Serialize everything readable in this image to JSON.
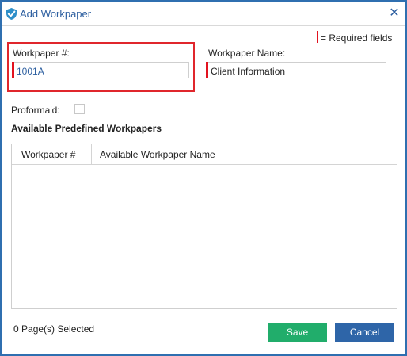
{
  "dialog": {
    "title": "Add Workpaper",
    "close_glyph": "✕"
  },
  "legend": {
    "required_text": "= Required fields",
    "required_color": "#e2131f"
  },
  "form": {
    "workpaper_number_label": "Workpaper #:",
    "workpaper_number_value": "1001A",
    "workpaper_name_label": "Workpaper Name:",
    "workpaper_name_value": "Client Information",
    "proforma_label": "Proforma'd:",
    "proforma_checked": false
  },
  "predefined": {
    "section_title": "Available Predefined Workpapers",
    "columns": [
      "Workpaper #",
      "Available Workpaper Name",
      ""
    ],
    "rows": []
  },
  "footer": {
    "selected_count": "0",
    "selected_label": "Page(s) Selected",
    "save_label": "Save",
    "cancel_label": "Cancel"
  },
  "icons": {
    "app": "check-shield-icon",
    "close": "close-icon"
  },
  "colors": {
    "title_blue": "#2d5fa0",
    "highlight_red": "#e0262c",
    "save_green": "#21ad6b",
    "cancel_blue": "#2e65a8"
  }
}
